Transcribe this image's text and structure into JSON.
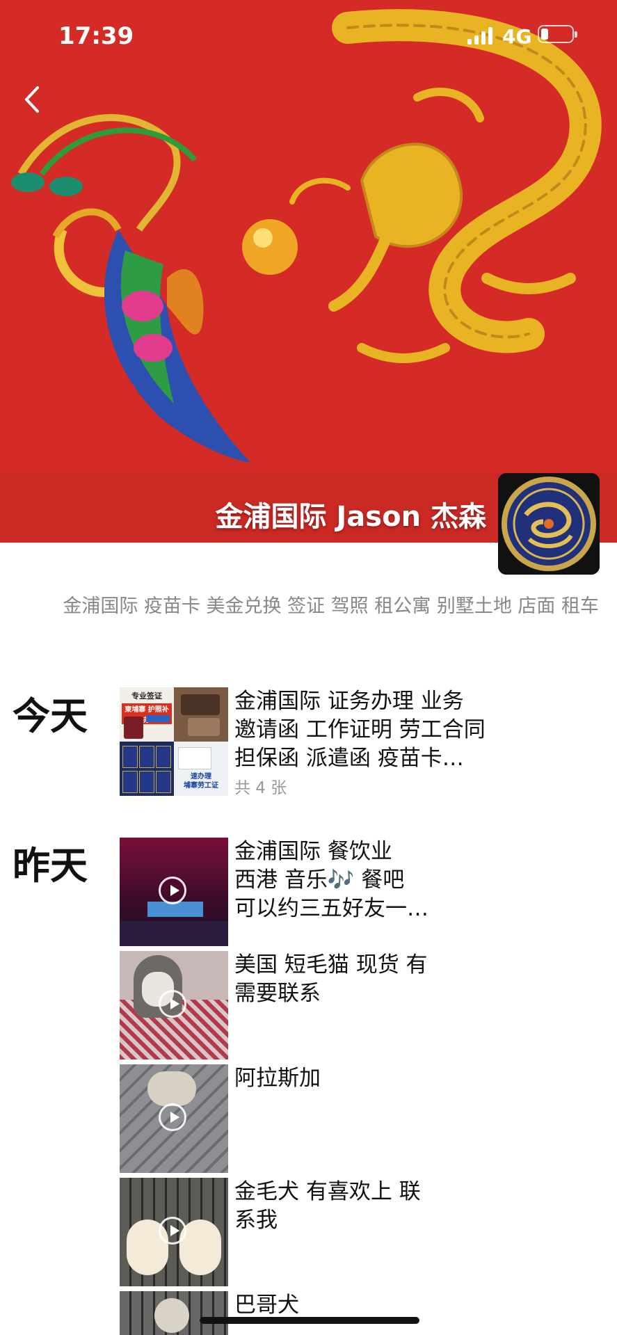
{
  "status_bar": {
    "time": "17:39",
    "network": "4G"
  },
  "profile": {
    "name": "金浦国际 Jason 杰森",
    "signature": "金浦国际 疫苗卡 美金兑换 签证 驾照 租公寓 别墅土地 店面 租车"
  },
  "sections": [
    {
      "day": "今天",
      "posts": [
        {
          "text": "金浦国际 证务办理 业务\n邀请函 工作证明 劳工合同\n担保函  派遣函  疫苗卡…",
          "count": "共 4 张"
        }
      ]
    },
    {
      "day": "昨天",
      "posts": [
        {
          "text": "金浦国际 餐饮业\n西港 音乐🎶 餐吧\n可以约三五好友一…"
        },
        {
          "text": "美国 短毛猫 现货 有\n需要联系"
        },
        {
          "text": "阿拉斯加"
        },
        {
          "text": "金毛犬 有喜欢上 联\n系我"
        },
        {
          "text": "巴哥犬"
        }
      ]
    }
  ],
  "thumb_labels": {
    "visa_top": "专业签证",
    "visa_red": "柬埔寨 护照补办",
    "work_permit": "速办理\n埔寨劳工证"
  },
  "colors": {
    "cover_red": "#d42b27",
    "dragon_gold": "#e8b423"
  }
}
